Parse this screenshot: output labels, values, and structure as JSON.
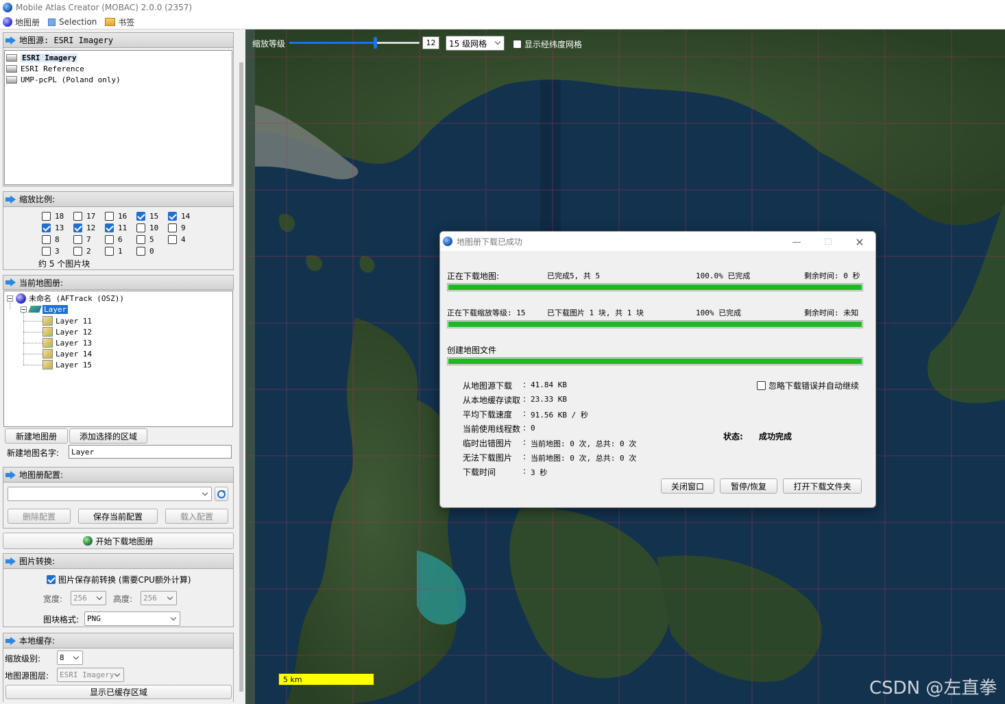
{
  "window": {
    "title": "Mobile Atlas Creator (MOBAC) 2.0.0 (2357)"
  },
  "menu": {
    "atlas": "地图册",
    "selection": "Selection",
    "bookmarks": "书签"
  },
  "map_source": {
    "header": "地图源: ESRI Imagery",
    "items": [
      {
        "label": "ESRI Imagery",
        "selected": true
      },
      {
        "label": "ESRI Reference",
        "selected": false
      },
      {
        "label": "UMP-pcPL (Poland only)",
        "selected": false
      }
    ]
  },
  "zoom_levels": {
    "header": "缩放比例:",
    "levels": [
      {
        "label": "18",
        "checked": false
      },
      {
        "label": "17",
        "checked": false
      },
      {
        "label": "16",
        "checked": false
      },
      {
        "label": "15",
        "checked": true
      },
      {
        "label": "14",
        "checked": true
      },
      {
        "label": "13",
        "checked": true
      },
      {
        "label": "12",
        "checked": true
      },
      {
        "label": "11",
        "checked": true
      },
      {
        "label": "10",
        "checked": false
      },
      {
        "label": "9",
        "checked": false
      },
      {
        "label": "8",
        "checked": false
      },
      {
        "label": "7",
        "checked": false
      },
      {
        "label": "6",
        "checked": false
      },
      {
        "label": "5",
        "checked": false
      },
      {
        "label": "4",
        "checked": false
      },
      {
        "label": "3",
        "checked": false
      },
      {
        "label": "2",
        "checked": false
      },
      {
        "label": "1",
        "checked": false
      },
      {
        "label": "0",
        "checked": false
      }
    ],
    "tile_count": "约 5 个图片块"
  },
  "current_atlas": {
    "header": "当前地图册:",
    "root": "未命名 (AFTrack (OSZ))",
    "layer": "Layer",
    "maps": [
      "Layer 11",
      "Layer 12",
      "Layer 13",
      "Layer 14",
      "Layer 15"
    ],
    "new_map_button": "新建地图册",
    "add_selection_button": "添加选择的区域",
    "new_map_name_label": "新建地图名字:",
    "new_map_name_value": "Layer"
  },
  "atlas_profile": {
    "header": "地图册配置:",
    "delete_button": "删除配置",
    "save_button": "保存当前配置",
    "load_button": "载入配置"
  },
  "start_download_button": "开始下载地图册",
  "tile_conversion": {
    "header": "图片转换:",
    "convert_label": "图片保存前转换 (需要CPU额外计算)",
    "convert_checked": true,
    "width_label": "宽度:",
    "width_value": "256",
    "height_label": "高度:",
    "height_value": "256",
    "format_label": "图块格式:",
    "format_value": "PNG"
  },
  "tile_store": {
    "header": "本地缓存:",
    "zoom_label": "缩放级别:",
    "zoom_value": "8",
    "source_label": "地图源图层:",
    "source_value": "ESRI Imagery",
    "show_cached_button": "显示已缓存区域"
  },
  "map_toolbar": {
    "zoom_label": "缩放等级",
    "zoom_value": "12",
    "zoom_fraction": 0.66,
    "grid_value": "15 级网格",
    "show_latlon_label": "显示经纬度网格"
  },
  "scalebar": "5 km",
  "watermark": "CSDN @左直拳",
  "dialog": {
    "title": "地图册下载已成功",
    "row1": {
      "label": "正在下载地图:",
      "progress": "已完成5, 共 5",
      "percent": "100.0% 已完成",
      "remaining": "剩余时间: 0 秒",
      "fill": 1.0
    },
    "row2": {
      "label": "正在下载缩放等级: 15",
      "progress": "已下载图片 1 块, 共 1 块",
      "percent": "100% 已完成",
      "remaining": "剩余时间: 未知",
      "fill": 1.0
    },
    "row3": {
      "label": "创建地图文件",
      "fill": 1.0
    },
    "stats": [
      {
        "label": "从地图源下载",
        "value": "41.84 KB"
      },
      {
        "label": "从本地缓存读取",
        "value": "23.33 KB"
      },
      {
        "label": "平均下载速度",
        "value": "91.56 KB / 秒"
      },
      {
        "label": "当前使用线程数",
        "value": "0"
      },
      {
        "label": "临时出错图片",
        "value": "当前地图: 0 次, 总共: 0 次"
      },
      {
        "label": "无法下载图片",
        "value": "当前地图: 0 次, 总共: 0 次"
      },
      {
        "label": "下载时间",
        "value": "3 秒"
      }
    ],
    "ignore_errors_label": "忽略下载错误并自动继续",
    "status_label": "状态:",
    "status_value": "成功完成",
    "close_button": "关闭窗口",
    "pause_button": "暂停/恢复",
    "open_folder_button": "打开下载文件夹"
  }
}
